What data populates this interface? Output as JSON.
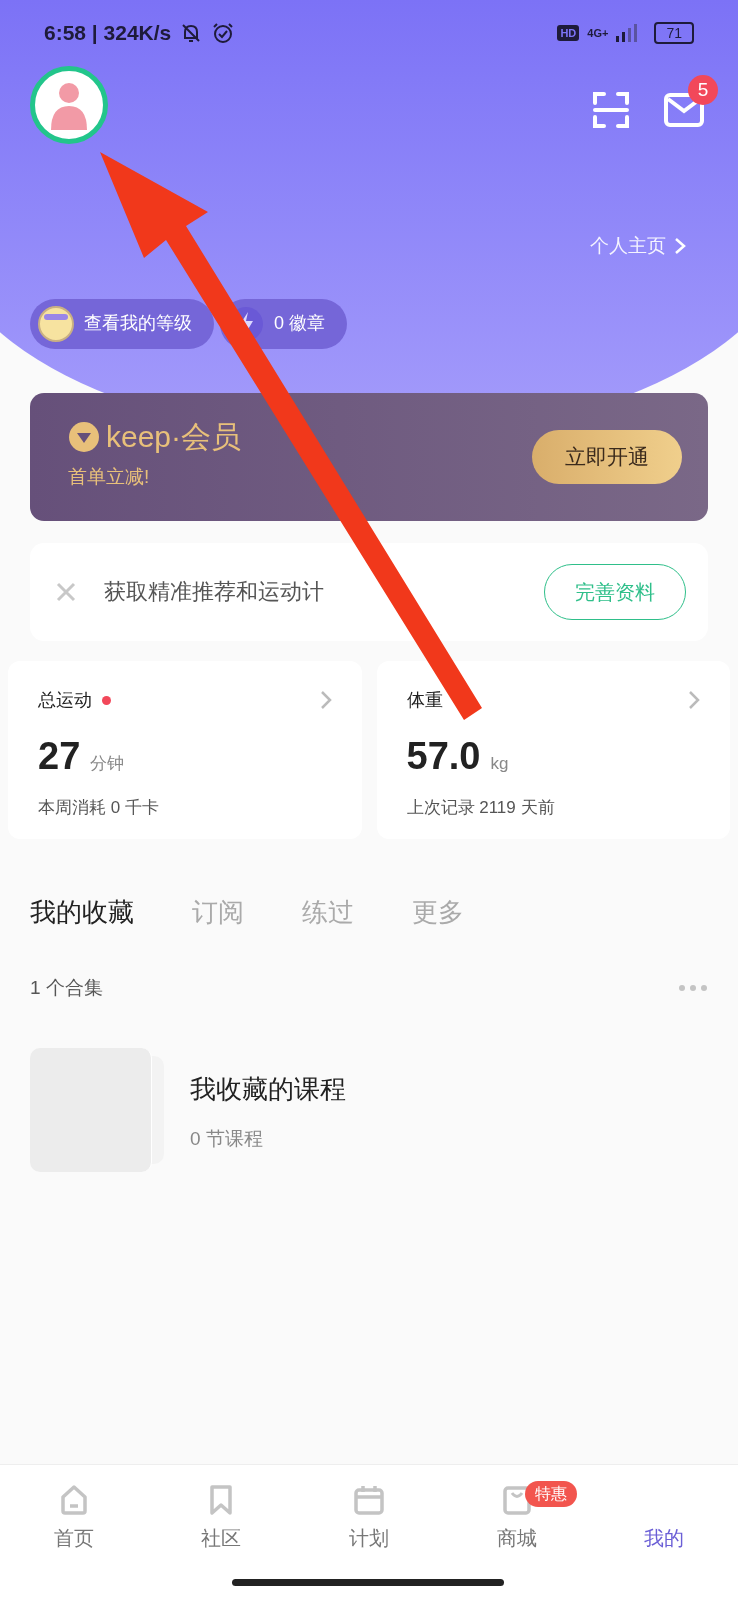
{
  "status_bar": {
    "time": "6:58 | 324K/s",
    "hd": "HD",
    "network": "4G+",
    "battery": "71"
  },
  "header": {
    "messages_badge": "5",
    "profile_link": "个人主页"
  },
  "pills": [
    {
      "label": "查看我的等级",
      "kind": "level"
    },
    {
      "label": "0 徽章",
      "kind": "badge"
    }
  ],
  "vip_card": {
    "brand": "keep",
    "title": "·会员",
    "subtitle": "首单立减!",
    "button": "立即开通"
  },
  "profile_tip": {
    "text": "获取精准推荐和运动计",
    "button": "完善资料"
  },
  "stats": [
    {
      "title": "总运动",
      "alert": true,
      "value": "27",
      "unit": "分钟",
      "note": "本周消耗 0 千卡"
    },
    {
      "title": "体重",
      "alert": false,
      "value": "57.0",
      "unit": "kg",
      "note": "上次记录 2119 天前"
    }
  ],
  "tabs": [
    {
      "label": "我的收藏",
      "selected": true
    },
    {
      "label": "订阅",
      "selected": false
    },
    {
      "label": "练过",
      "selected": false
    },
    {
      "label": "更多",
      "selected": false
    }
  ],
  "collections": {
    "count": "1 个合集",
    "items": [
      {
        "title": "我收藏的课程",
        "subtitle": "0 节课程"
      }
    ]
  },
  "bottom_nav": [
    {
      "label": "首页",
      "selected": false
    },
    {
      "label": "社区",
      "selected": false
    },
    {
      "label": "计划",
      "selected": false
    },
    {
      "label": "商城",
      "selected": false,
      "badge": "特惠"
    },
    {
      "label": "我的",
      "selected": true
    }
  ]
}
